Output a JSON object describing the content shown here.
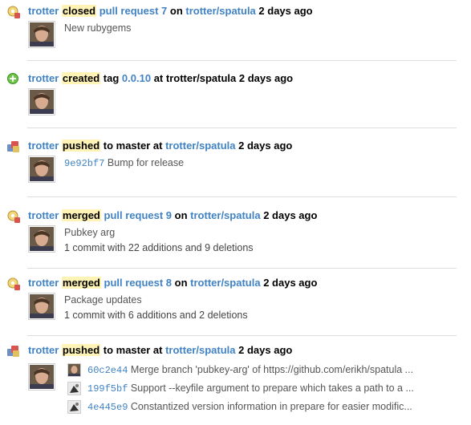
{
  "feed": [
    {
      "kind": "pr",
      "actor": "trotter",
      "action": "closed",
      "object": "pull request 7",
      "connector": "on",
      "repo": "trotter/spatula",
      "time": "2 days ago",
      "message": "New rubygems"
    },
    {
      "kind": "tag",
      "actor": "trotter",
      "action": "created",
      "pre_object": "tag",
      "object": "0.0.10",
      "connector": "at trotter/spatula",
      "time": "2 days ago"
    },
    {
      "kind": "push",
      "actor": "trotter",
      "action": "pushed",
      "middle": "to master at",
      "repo": "trotter/spatula",
      "time": "2 days ago",
      "sha": "9e92bf7",
      "message": "Bump for release"
    },
    {
      "kind": "pr",
      "actor": "trotter",
      "action": "merged",
      "object": "pull request 9",
      "connector": "on",
      "repo": "trotter/spatula",
      "time": "2 days ago",
      "message": "Pubkey arg",
      "summary": "1 commit with 22 additions and 9 deletions"
    },
    {
      "kind": "pr",
      "actor": "trotter",
      "action": "merged",
      "object": "pull request 8",
      "connector": "on",
      "repo": "trotter/spatula",
      "time": "2 days ago",
      "message": "Package updates",
      "summary": "1 commit with 6 additions and 2 deletions"
    },
    {
      "kind": "push",
      "actor": "trotter",
      "action": "pushed",
      "middle": "to master at",
      "repo": "trotter/spatula",
      "time": "2 days ago",
      "commits": [
        {
          "sha": "60c2e44",
          "message": "Merge branch 'pubkey-arg' of https://github.com/erikh/spatula ..."
        },
        {
          "sha": "199f5bf",
          "message": "Support --keyfile argument to prepare which takes a path to a ..."
        },
        {
          "sha": "4e445e9",
          "message": "Constantized version information in prepare for easier modific..."
        }
      ]
    }
  ],
  "colors": {
    "link": "#4183c4",
    "highlight": "#fff3b5",
    "divider": "#dddddd"
  },
  "icons": {
    "pr": "pull-request-icon",
    "tag": "create-icon",
    "push": "push-icon"
  }
}
